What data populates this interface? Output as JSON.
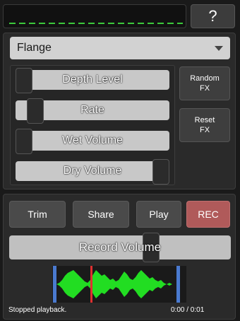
{
  "help_button": {
    "label": "?"
  },
  "effect": {
    "selected": "Flange"
  },
  "sliders": [
    {
      "label": "Depth Level",
      "value": 0.0
    },
    {
      "label": "Rate",
      "value": 0.08
    },
    {
      "label": "Wet Volume",
      "value": 0.0
    },
    {
      "label": "Dry Volume",
      "value": 1.0
    }
  ],
  "fx_buttons": {
    "random": {
      "line1": "Random",
      "line2": "FX"
    },
    "reset": {
      "line1": "Reset",
      "line2": "FX"
    }
  },
  "actions": {
    "trim": "Trim",
    "share": "Share",
    "play": "Play",
    "rec": "REC"
  },
  "record_volume": {
    "label": "Record Volume",
    "value": 0.65
  },
  "status": {
    "message": "Stopped playback.",
    "time": "0:00 / 0:01"
  },
  "colors": {
    "waveform": "#22dd22",
    "playhead": "#e03030",
    "markers": "#4a7ad0",
    "display_dashes": "#3cc83c",
    "rec_button": "#b05a5a"
  }
}
